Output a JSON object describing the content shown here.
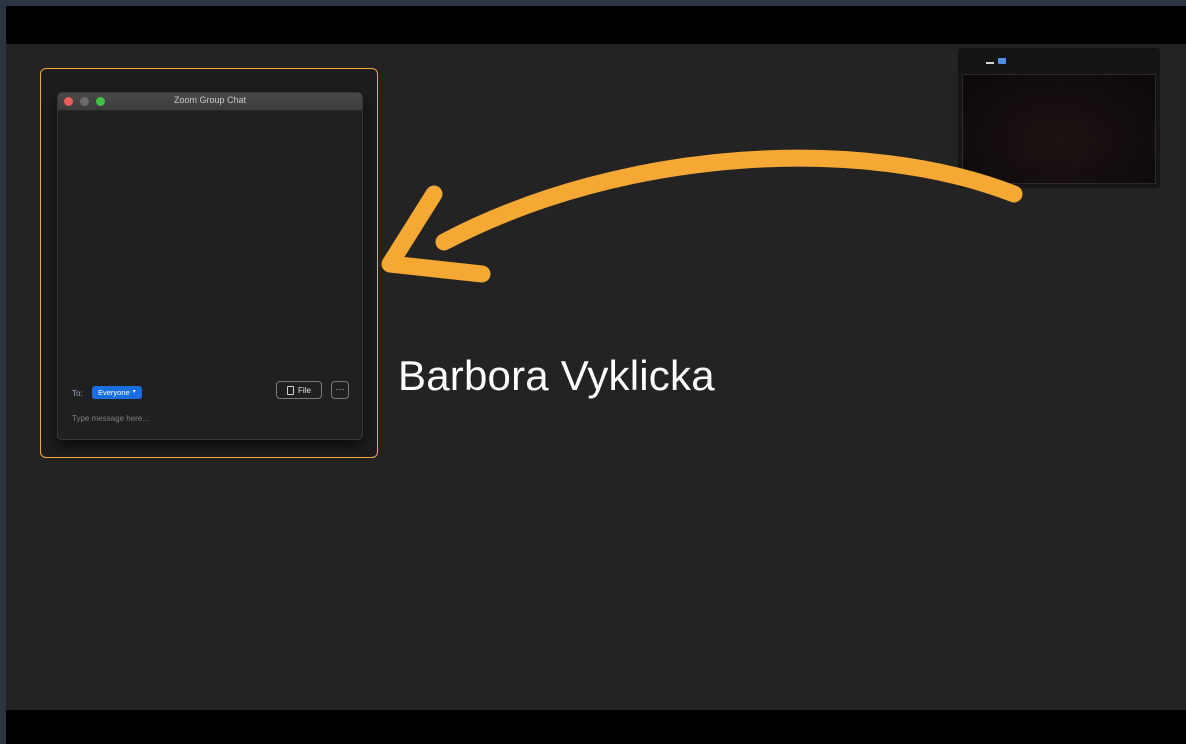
{
  "chat_window": {
    "title": "Zoom Group Chat",
    "to_label": "To:",
    "recipient": "Everyone",
    "recipient_caret": "▾",
    "file_label": "File",
    "more_label": "···",
    "message_placeholder": "Type message here..."
  },
  "participant": {
    "name": "Barbora Vyklicka"
  },
  "colors": {
    "highlight": "#f2a93b",
    "arrow": "#f5a833",
    "recipient_pill": "#1a6fe0"
  }
}
